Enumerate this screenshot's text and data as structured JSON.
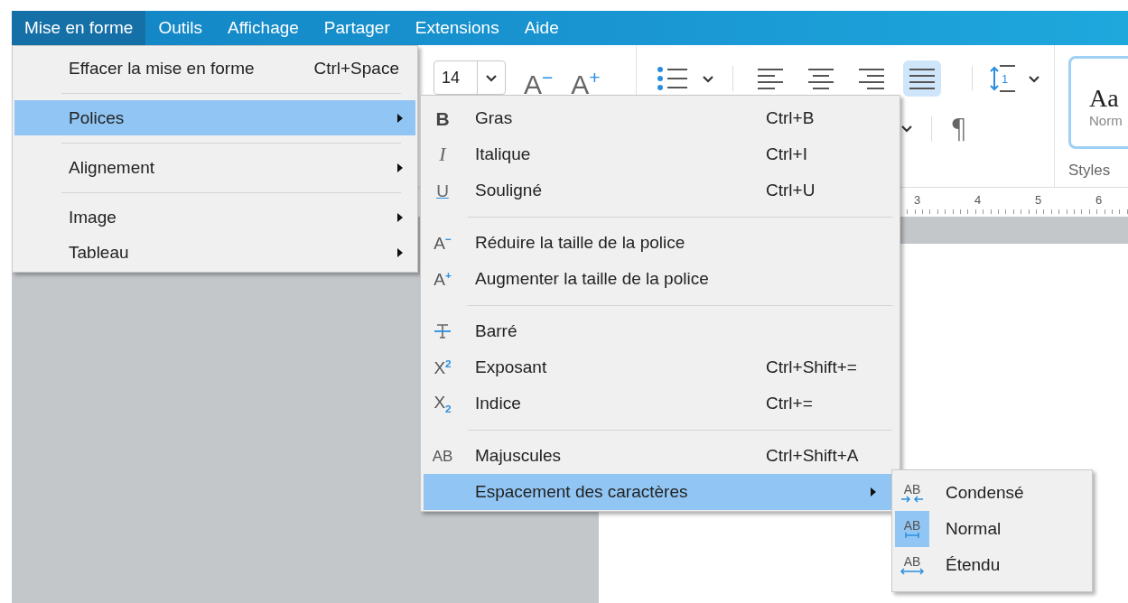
{
  "menubar": [
    {
      "label": "Mise en forme",
      "selected": true
    },
    {
      "label": "Outils",
      "selected": false
    },
    {
      "label": "Affichage",
      "selected": false
    },
    {
      "label": "Partager",
      "selected": false
    },
    {
      "label": "Extensions",
      "selected": false
    },
    {
      "label": "Aide",
      "selected": false
    }
  ],
  "toolbar": {
    "font_size": "14",
    "font_size_buttons": [
      "A$^{−}$",
      "A$^{+}$"
    ],
    "alignment": [
      {
        "selected": false
      },
      {
        "selected": false
      },
      {
        "selected": false
      },
      {
        "selected": true
      }
    ],
    "line_spacing_value": "1",
    "paragraph_mark": "¶",
    "style_preview": {
      "sample": "Aa",
      "name": "Norm"
    },
    "styles_label": "Styles"
  },
  "ruler": {
    "numbers": [
      "3",
      "4",
      "5",
      "6"
    ]
  },
  "menu": {
    "items": [
      {
        "kind": "item",
        "label": "Effacer la mise en forme",
        "shortcut": "Ctrl+Space",
        "submenu": false,
        "selected": false
      },
      {
        "kind": "separator"
      },
      {
        "kind": "item",
        "label": "Polices",
        "submenu": true,
        "selected": true
      },
      {
        "kind": "separator"
      },
      {
        "kind": "item",
        "label": "Alignement",
        "submenu": true,
        "selected": false
      },
      {
        "kind": "separator"
      },
      {
        "kind": "item",
        "label": "Image",
        "submenu": true,
        "selected": false
      },
      {
        "kind": "item",
        "label": "Tableau",
        "submenu": true,
        "selected": false
      }
    ]
  },
  "submenu": {
    "items": [
      {
        "kind": "bold",
        "glyph": "B",
        "label": "Gras",
        "shortcut": "Ctrl+B",
        "submenu": false,
        "selected": false
      },
      {
        "kind": "italic",
        "glyph": "I",
        "label": "Italique",
        "shortcut": "Ctrl+I",
        "submenu": false,
        "selected": false
      },
      {
        "kind": "underline",
        "glyph": "U",
        "label": "Souligné",
        "shortcut": "Ctrl+U",
        "submenu": false,
        "selected": false
      },
      {
        "kind": "separator"
      },
      {
        "kind": "shrink",
        "glyph": "A$^{−}$",
        "label": "Réduire la taille de la police",
        "submenu": false,
        "selected": false
      },
      {
        "kind": "grow",
        "glyph": "A$^{+}$",
        "label": "Augmenter la taille de la police",
        "submenu": false,
        "selected": false
      },
      {
        "kind": "separator"
      },
      {
        "kind": "strike",
        "label": "Barré",
        "submenu": false,
        "selected": false
      },
      {
        "kind": "superscript",
        "glyph": "X$^{2}$",
        "label": "Exposant",
        "shortcut": "Ctrl+Shift+=",
        "submenu": false,
        "selected": false
      },
      {
        "kind": "subscript",
        "glyph": "X$_{2}$",
        "label": "Indice",
        "shortcut": "Ctrl+=",
        "submenu": false,
        "selected": false
      },
      {
        "kind": "separator"
      },
      {
        "kind": "caps",
        "glyph": "AB",
        "label": "Majuscules",
        "shortcut": "Ctrl+Shift+A",
        "submenu": false,
        "selected": false
      },
      {
        "kind": "plain",
        "label": "Espacement des caractères",
        "submenu": true,
        "selected": true
      }
    ]
  },
  "spacing_menu": {
    "items": [
      {
        "kind": "condensed",
        "glyph": "AB",
        "label": "Condensé",
        "selected": false
      },
      {
        "kind": "normal",
        "glyph": "AB",
        "label": "Normal",
        "selected": true
      },
      {
        "kind": "expanded",
        "glyph": "AB",
        "label": "Étendu",
        "selected": false
      }
    ]
  }
}
